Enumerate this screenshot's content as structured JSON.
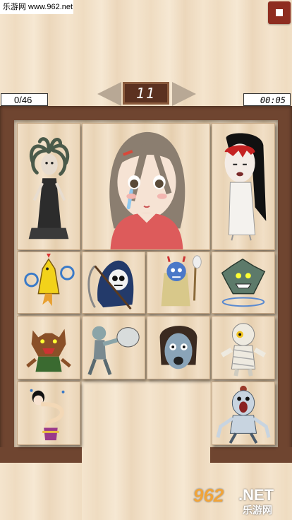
{
  "watermark": {
    "site": "乐游网 www.962.net",
    "logo_number": "962",
    "logo_suffix": ".NET",
    "logo_cn": "乐游网"
  },
  "header": {
    "level": "11",
    "progress": "0/46",
    "timer": "00:05"
  },
  "colors": {
    "frame": "#6f4530",
    "menu_button": "#8e2d20",
    "level_bg": "#5b3120"
  },
  "tiles": [
    {
      "name": "medusa-tile",
      "character": "medusa"
    },
    {
      "name": "girl-portrait-tile",
      "character": "crying-girl"
    },
    {
      "name": "bloody-woman-tile",
      "character": "long-haired-ghost"
    },
    {
      "name": "yellow-bird-tile",
      "character": "yellow-bird-with-blue-flames"
    },
    {
      "name": "grim-reaper-tile",
      "character": "grim-reaper"
    },
    {
      "name": "namahage-tile",
      "character": "blue-oni-with-straw-coat"
    },
    {
      "name": "green-monster-tile",
      "character": "green-gargoyle"
    },
    {
      "name": "werewolf-tile",
      "character": "werewolf"
    },
    {
      "name": "zombie-punch-tile",
      "character": "zombie-punching"
    },
    {
      "name": "zombie-head-tile",
      "character": "zombie-head"
    },
    {
      "name": "mummy-tile",
      "character": "mummy"
    },
    {
      "name": "rokurokubi-tile",
      "character": "long-neck-woman"
    },
    {
      "name": "screaming-monster-tile",
      "character": "pale-screaming-monster"
    }
  ]
}
